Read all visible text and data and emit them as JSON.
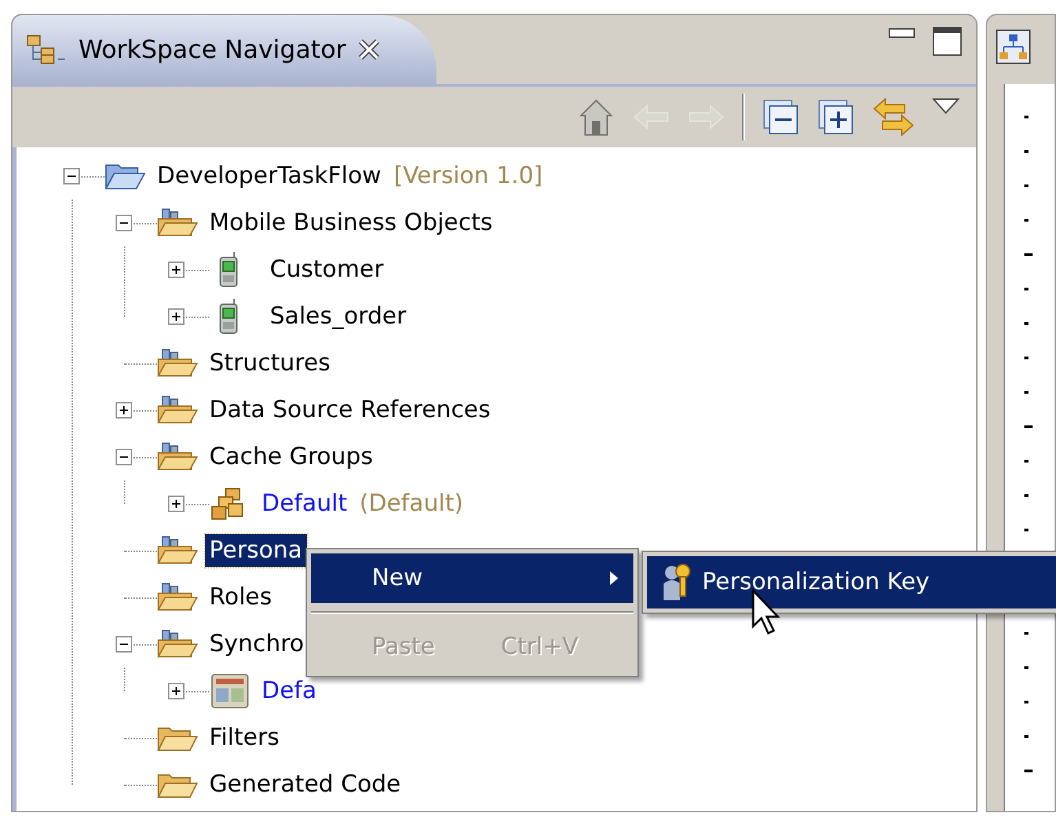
{
  "view": {
    "title": "WorkSpace Navigator",
    "toolbar": [
      {
        "kind": "home",
        "disabled": false
      },
      {
        "kind": "back",
        "disabled": true
      },
      {
        "kind": "forward",
        "disabled": true
      },
      {
        "kind": "separator"
      },
      {
        "kind": "collapse",
        "disabled": false
      },
      {
        "kind": "expand",
        "disabled": false
      },
      {
        "kind": "link",
        "disabled": false
      },
      {
        "kind": "menu",
        "disabled": false
      }
    ]
  },
  "tree": [
    {
      "label": "DeveloperTaskFlow",
      "annotation": "[Version 1.0]",
      "kind": "project",
      "expanded": true,
      "selected": false,
      "linked": false,
      "children": [
        {
          "label": "Mobile Business Objects",
          "kind": "package",
          "expanded": true,
          "selected": false,
          "linked": false,
          "children": [
            {
              "label": "Customer",
              "kind": "device",
              "expanded": false,
              "selected": false,
              "linked": false
            },
            {
              "label": "Sales_order",
              "kind": "device",
              "expanded": false,
              "selected": false,
              "linked": false
            }
          ]
        },
        {
          "label": "Structures",
          "kind": "package",
          "selected": false,
          "linked": false
        },
        {
          "label": "Data Source References",
          "kind": "package",
          "expanded": false,
          "selected": false,
          "linked": false
        },
        {
          "label": "Cache Groups",
          "kind": "package",
          "expanded": true,
          "selected": false,
          "linked": false,
          "children": [
            {
              "label": "Default",
              "annotation": "(Default)",
              "kind": "cache",
              "expanded": false,
              "selected": false,
              "linked": true
            }
          ]
        },
        {
          "label": "Persona",
          "kind": "package",
          "selected": true,
          "linked": false
        },
        {
          "label": "Roles",
          "kind": "package",
          "selected": false,
          "linked": false
        },
        {
          "label": "Synchro",
          "kind": "package",
          "expanded": true,
          "selected": false,
          "linked": false,
          "children": [
            {
              "label": "Defa",
              "kind": "sync",
              "expanded": false,
              "selected": false,
              "linked": true
            }
          ]
        },
        {
          "label": "Filters",
          "kind": "folder",
          "selected": false,
          "linked": false
        },
        {
          "label": "Generated Code",
          "kind": "folder",
          "selected": false,
          "linked": false
        }
      ]
    }
  ],
  "context_menu": {
    "items": [
      {
        "kind": "item",
        "label": "New",
        "submenu": true,
        "selected": true,
        "disabled": false
      },
      {
        "kind": "separator"
      },
      {
        "kind": "item",
        "label": "Paste",
        "shortcut": "Ctrl+V",
        "submenu": false,
        "selected": false,
        "disabled": true
      }
    ]
  },
  "submenu": {
    "items": [
      {
        "label": "Personalization Key",
        "selected": true
      }
    ]
  }
}
